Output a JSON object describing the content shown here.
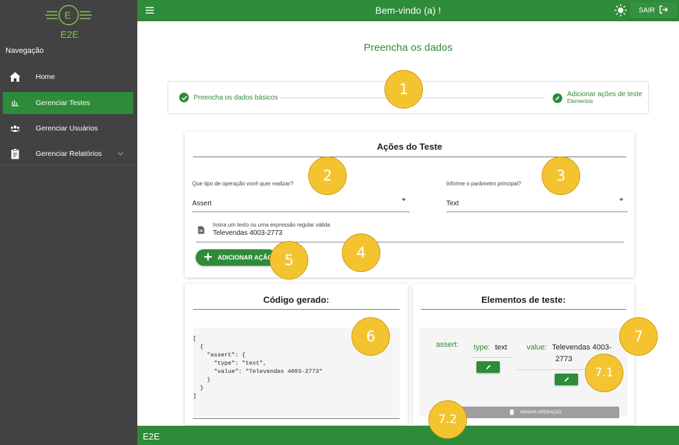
{
  "sidebar": {
    "logo_text": "E2E",
    "logo_letter": "E",
    "heading": "Navegação",
    "items": [
      {
        "label": "Home",
        "icon": "home-icon"
      },
      {
        "label": "Gerenciar Testes",
        "icon": "chart-icon",
        "active": true
      },
      {
        "label": "Gerenciar Usuários",
        "icon": "users-icon"
      },
      {
        "label": "Gerenciar Relatórios",
        "icon": "clipboard-icon"
      }
    ]
  },
  "topbar": {
    "welcome": "Bem-vindo (a) !",
    "exit_label": "SAIR"
  },
  "page": {
    "title": "Preencha os dados"
  },
  "stepper": {
    "step1_label": "Preencha os dados básicos",
    "step2_label": "Adicionar ações de teste",
    "step2_sub": "Elementos"
  },
  "actions": {
    "title": "Ações do Teste",
    "operation_label": "Que tipo de operação você quer realizar?",
    "operation_value": "Assert",
    "param_label": "Informe o parâmetro principal?",
    "param_value": "Text",
    "text_label": "Insira um texto ou uma expressão regular válida",
    "text_value": "Televendas 4003-2773",
    "add_button": "ADICIONAR AÇÃO"
  },
  "code": {
    "title": "Código gerado:",
    "content": "[\n  {\n    \"assert\": {\n      \"type\": \"text\",\n      \"value\": \"Televendas 4003-2773\"\n    }\n  }\n]"
  },
  "elements": {
    "title": "Elementos de teste:",
    "operation_key": "assert:",
    "type_key": "type:",
    "type_value": "text",
    "value_key": "value:",
    "value_value_line1": "Televendas 4003-",
    "value_value_line2": "2773",
    "delete_button": "APAGAR OPERAÇÃO"
  },
  "footer": {
    "text": "E2E"
  },
  "callouts": [
    "1",
    "2",
    "3",
    "4",
    "5",
    "6",
    "7",
    "7.1",
    "7.2"
  ],
  "colors": {
    "primary_green": "#2e8b3a",
    "sidebar_bg": "#424242",
    "callout_yellow": "#f4c430",
    "delete_gray": "#9e9e9e"
  }
}
